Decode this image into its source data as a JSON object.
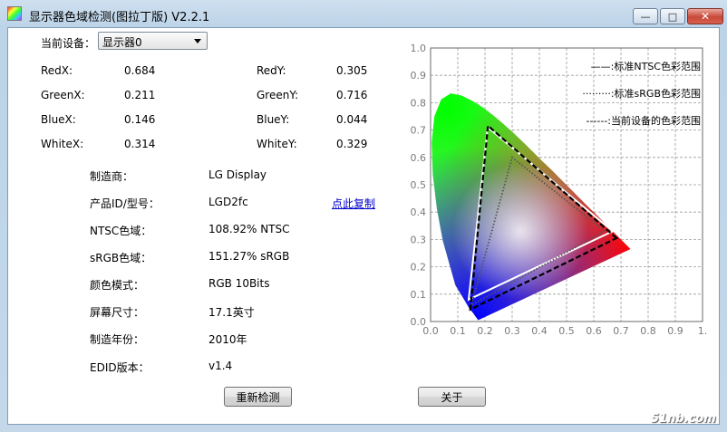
{
  "window": {
    "title": "显示器色域检测(图拉丁版) V2.2.1",
    "min_glyph": "—",
    "max_glyph": "□",
    "close_glyph": "✕"
  },
  "device": {
    "label": "当前设备：",
    "selected": "显示器0"
  },
  "coords": {
    "red_x_label": "RedX:",
    "red_x": "0.684",
    "red_y_label": "RedY:",
    "red_y": "0.305",
    "green_x_label": "GreenX:",
    "green_x": "0.211",
    "green_y_label": "GreenY:",
    "green_y": "0.716",
    "blue_x_label": "BlueX:",
    "blue_x": "0.146",
    "blue_y_label": "BlueY:",
    "blue_y": "0.044",
    "white_x_label": "WhiteX:",
    "white_x": "0.314",
    "white_y_label": "WhiteY:",
    "white_y": "0.329"
  },
  "info": {
    "manufacturer_label": "制造商：",
    "manufacturer": "LG Display",
    "product_label": "产品ID/型号：",
    "product": "LGD2fc",
    "copy_link": "点此复制",
    "ntsc_label": "NTSC色域：",
    "ntsc": "108.92% NTSC",
    "srgb_label": "sRGB色域：",
    "srgb": "151.27% sRGB",
    "color_mode_label": "颜色模式：",
    "color_mode": "RGB 10Bits",
    "screen_size_label": "屏幕尺寸：",
    "screen_size": "17.1英寸",
    "year_label": "制造年份：",
    "year": "2010年",
    "edid_label": "EDID版本：",
    "edid": "v1.4"
  },
  "buttons": {
    "redetect": "重新检测",
    "close": "关于"
  },
  "watermark": "51nb.com",
  "chart_data": {
    "type": "scatter",
    "title": "",
    "xlabel": "",
    "ylabel": "",
    "xlim": [
      0,
      1.0
    ],
    "ylim": [
      0,
      1.0
    ],
    "x_ticks": [
      "0.0",
      "0.1",
      "0.2",
      "0.3",
      "0.4",
      "0.5",
      "0.6",
      "0.7",
      "0.8",
      "0.9",
      "1."
    ],
    "y_ticks": [
      "0.0",
      "0.1",
      "0.2",
      "0.3",
      "0.4",
      "0.5",
      "0.6",
      "0.7",
      "0.8",
      "0.9",
      "1.0"
    ],
    "grid": true,
    "legend_position": "top-right",
    "legend": [
      {
        "text": "——:标准NTSC色彩范围",
        "style": "solid"
      },
      {
        "text": "·········:标准sRGB色彩范围",
        "style": "dotted"
      },
      {
        "text": "------:当前设备的色彩范围",
        "style": "dashed"
      }
    ],
    "spectral_locus": [
      [
        0.175,
        0.005
      ],
      [
        0.17,
        0.012
      ],
      [
        0.164,
        0.02
      ],
      [
        0.157,
        0.03
      ],
      [
        0.144,
        0.045
      ],
      [
        0.124,
        0.079
      ],
      [
        0.091,
        0.133
      ],
      [
        0.045,
        0.295
      ],
      [
        0.023,
        0.413
      ],
      [
        0.008,
        0.538
      ],
      [
        0.004,
        0.655
      ],
      [
        0.014,
        0.75
      ],
      [
        0.039,
        0.812
      ],
      [
        0.074,
        0.834
      ],
      [
        0.114,
        0.826
      ],
      [
        0.155,
        0.806
      ],
      [
        0.193,
        0.782
      ],
      [
        0.23,
        0.754
      ],
      [
        0.266,
        0.724
      ],
      [
        0.302,
        0.692
      ],
      [
        0.337,
        0.659
      ],
      [
        0.373,
        0.624
      ],
      [
        0.408,
        0.589
      ],
      [
        0.444,
        0.555
      ],
      [
        0.479,
        0.52
      ],
      [
        0.512,
        0.487
      ],
      [
        0.544,
        0.455
      ],
      [
        0.575,
        0.424
      ],
      [
        0.603,
        0.397
      ],
      [
        0.627,
        0.373
      ],
      [
        0.648,
        0.351
      ],
      [
        0.666,
        0.334
      ],
      [
        0.68,
        0.32
      ],
      [
        0.691,
        0.309
      ],
      [
        0.7,
        0.3
      ],
      [
        0.707,
        0.293
      ],
      [
        0.735,
        0.265
      ]
    ],
    "series": [
      {
        "name": "标准NTSC色彩范围",
        "style": "solid",
        "points": [
          [
            0.67,
            0.33
          ],
          [
            0.21,
            0.71
          ],
          [
            0.14,
            0.08
          ]
        ]
      },
      {
        "name": "标准sRGB色彩范围",
        "style": "dotted",
        "points": [
          [
            0.64,
            0.33
          ],
          [
            0.3,
            0.6
          ],
          [
            0.15,
            0.06
          ]
        ]
      },
      {
        "name": "当前设备的色彩范围",
        "style": "dashed",
        "points": [
          [
            0.684,
            0.305
          ],
          [
            0.211,
            0.716
          ],
          [
            0.146,
            0.044
          ]
        ]
      }
    ]
  }
}
